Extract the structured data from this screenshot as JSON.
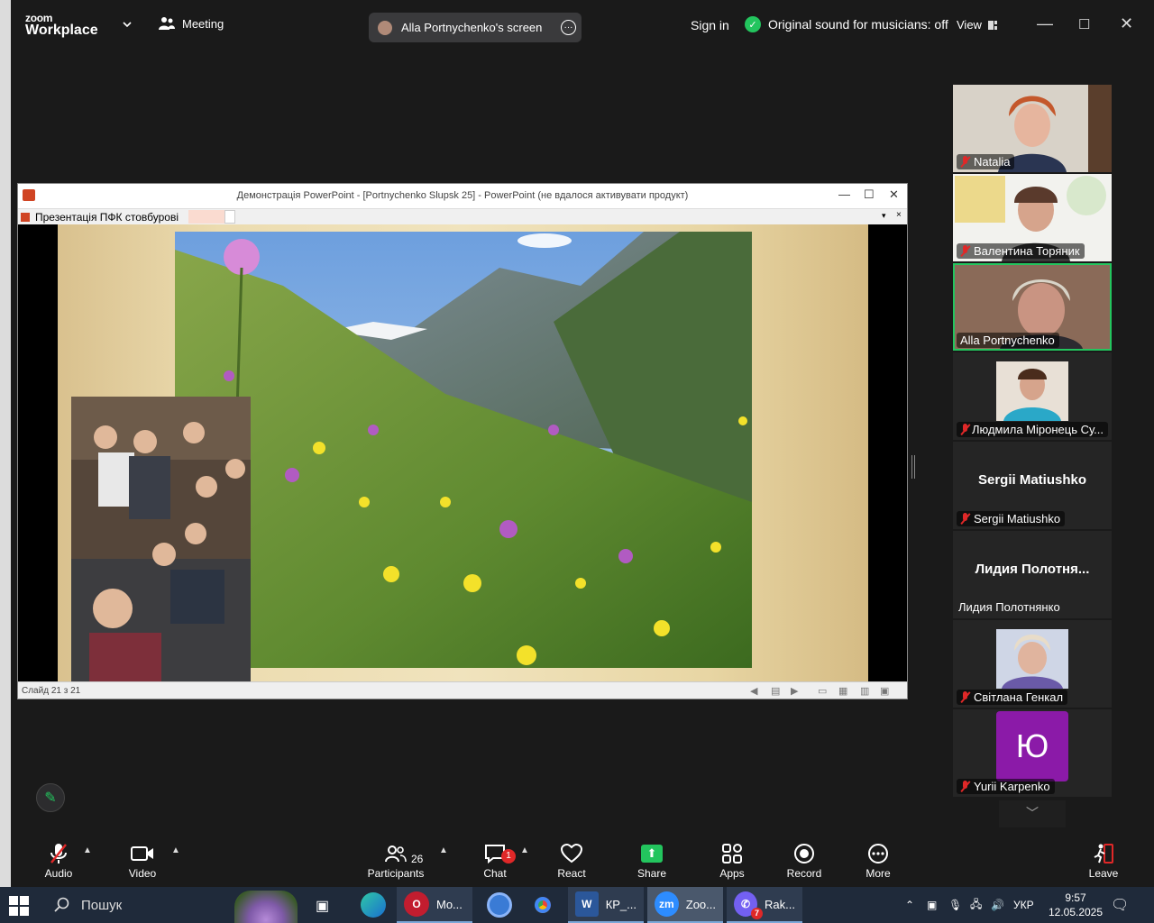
{
  "app": {
    "logo_line1": "zoom",
    "logo_line2": "Workplace",
    "meeting_label": "Meeting",
    "screen_label": "Alla Portnychenko's screen",
    "sign_in": "Sign in",
    "original_sound": "Original sound for musicians: off",
    "view_label": "View"
  },
  "ppt": {
    "title": "Демонстрація PowerPoint - [Portnychenko Slupsk 25] - PowerPoint (не вдалося активувати продукт)",
    "tab_label": "Презентація ПФК стовбурові",
    "status": "Слайд 21 з 21"
  },
  "participants": [
    {
      "name": "Natalia",
      "muted": true
    },
    {
      "name": "Валентина Торяник",
      "muted": true
    },
    {
      "name": "Alla Portnychenko",
      "muted": false
    },
    {
      "name": "Людмила Міронець Су...",
      "muted": true
    },
    {
      "name": "Sergii Matiushko",
      "big": "Sergii Matiushko",
      "muted": true
    },
    {
      "name": "Лидия Полотнянко",
      "big": "Лидия  Полотня...",
      "muted": false
    },
    {
      "name": "Світлана Генкал",
      "muted": true
    },
    {
      "name": "Yurii Karpenko",
      "initial": "Ю",
      "muted": true
    }
  ],
  "toolbar": {
    "audio": "Audio",
    "video": "Video",
    "participants": "Participants",
    "participants_count": "26",
    "chat": "Chat",
    "chat_badge": "1",
    "react": "React",
    "share": "Share",
    "apps": "Apps",
    "record": "Record",
    "more": "More",
    "leave": "Leave"
  },
  "taskbar": {
    "search": "Пошук",
    "apps": [
      {
        "label": "Mo...",
        "icon": "opera-icon"
      },
      {
        "label": "КР_...",
        "icon": "word-icon"
      },
      {
        "label": "Zoo...",
        "icon": "zoom-icon"
      },
      {
        "label": "Rak...",
        "icon": "viber-icon",
        "badge": "7"
      }
    ],
    "lang": "УКР",
    "time": "9:57",
    "date": "12.05.2025"
  },
  "colors": {
    "accent_green": "#23c55e",
    "mute_red": "#e02828",
    "chat_badge": "#e02828",
    "yu_avatar": "#8b1aa8"
  }
}
